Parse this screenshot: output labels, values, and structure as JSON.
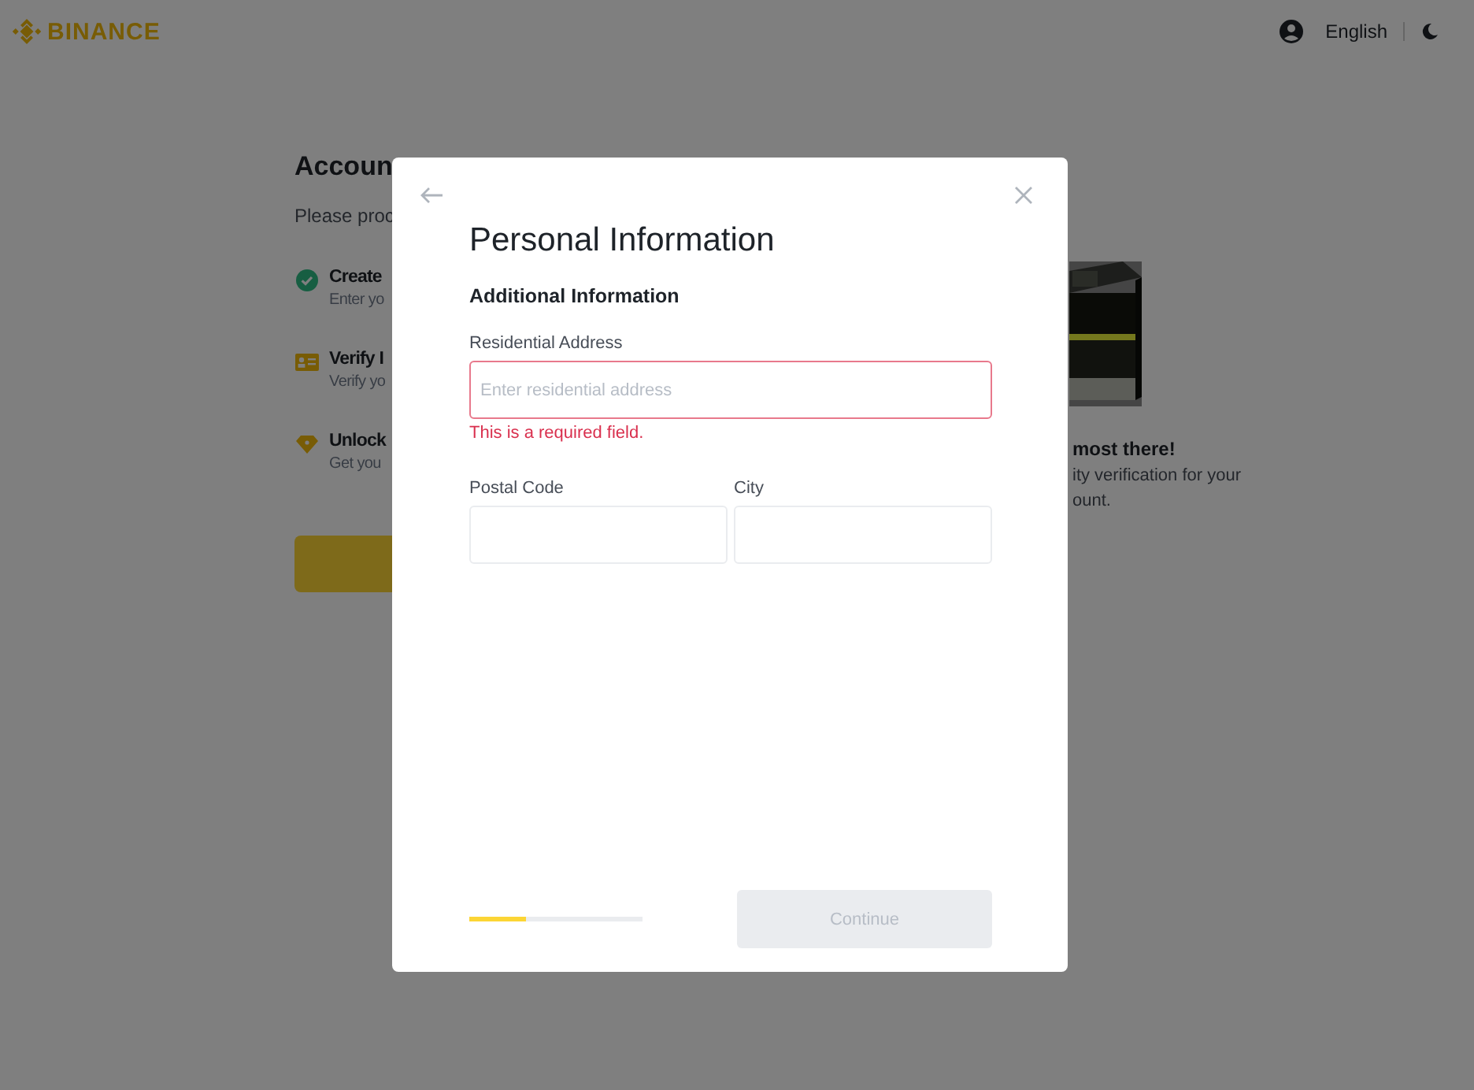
{
  "header": {
    "logo": "BINANCE",
    "language": "English"
  },
  "background": {
    "title": "Accoun",
    "subtitle": "Please proc",
    "steps": [
      {
        "kind": "done",
        "title": "Create",
        "desc": "Enter yo"
      },
      {
        "kind": "id",
        "title": "Verify I",
        "desc": "Verify yo"
      },
      {
        "kind": "unlock",
        "title": "Unlock",
        "desc": "Get you"
      }
    ],
    "side_heading": "most there!",
    "side_text": [
      "ity verification for your",
      "ount."
    ]
  },
  "modal": {
    "title": "Personal Information",
    "section": "Additional Information",
    "fields": [
      {
        "label": "Residential Address",
        "placeholder": "Enter residential address",
        "error": true,
        "error_text": "This is a required field."
      },
      {
        "label": "Postal Code",
        "error": false
      },
      {
        "label": "City",
        "error": false
      }
    ],
    "progress": {
      "level": 0.33
    },
    "continue": {
      "label": "Continue",
      "disabled": true
    }
  }
}
